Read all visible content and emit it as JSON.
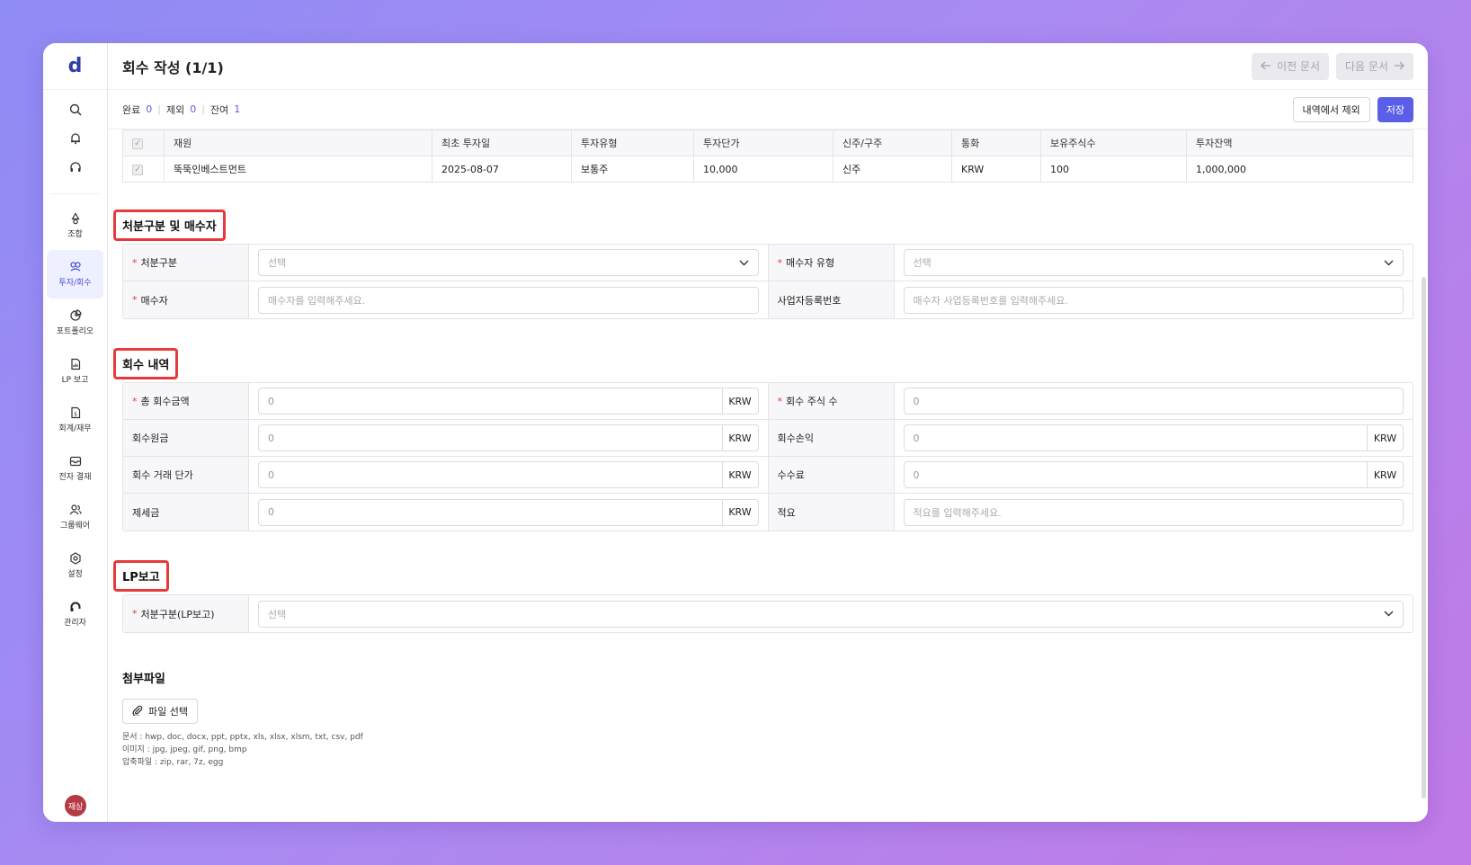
{
  "app": {
    "logo": "d"
  },
  "sidebar": {
    "items": [
      {
        "label": "조합",
        "icon": "recycle-icon"
      },
      {
        "label": "투자/회수",
        "icon": "investment-icon",
        "active": true
      },
      {
        "label": "포트폴리오",
        "icon": "pie-chart-icon"
      },
      {
        "label": "LP 보고",
        "icon": "report-icon"
      },
      {
        "label": "회계/재무",
        "icon": "accounting-icon"
      },
      {
        "label": "전자 결재",
        "icon": "inbox-icon"
      },
      {
        "label": "그룹웨어",
        "icon": "users-icon"
      },
      {
        "label": "설정",
        "icon": "settings-icon"
      },
      {
        "label": "관리자",
        "icon": "headset-icon"
      }
    ],
    "avatar": "재상"
  },
  "header": {
    "title": "회수 작성 (1/1)",
    "prev_label": "이전 문서",
    "next_label": "다음 문서"
  },
  "status": {
    "done_label": "완료",
    "done_count": "0",
    "excluded_label": "제외",
    "excluded_count": "0",
    "remaining_label": "잔여",
    "remaining_count": "1"
  },
  "toolbar": {
    "exclude_label": "내역에서 제외",
    "save_label": "저장"
  },
  "table": {
    "headers": [
      "재원",
      "최초 투자일",
      "투자유형",
      "투자단가",
      "신주/구주",
      "통화",
      "보유주식수",
      "투자잔액"
    ],
    "rows": [
      [
        "뚝뚝인베스트먼트",
        "2025-08-07",
        "보통주",
        "10,000",
        "신주",
        "KRW",
        "100",
        "1,000,000"
      ]
    ]
  },
  "disposal": {
    "title": "처분구분 및 매수자",
    "type_label": "처분구분",
    "type_placeholder": "선택",
    "buyer_type_label": "매수자 유형",
    "buyer_type_placeholder": "선택",
    "buyer_label": "매수자",
    "buyer_placeholder": "매수자를 입력해주세요.",
    "biz_no_label": "사업자등록번호",
    "biz_no_placeholder": "매수자 사업등록번호를 입력해주세요."
  },
  "recovery": {
    "title": "회수 내역",
    "total_label": "총 회수금액",
    "total_value": "0",
    "total_unit": "KRW",
    "shares_label": "회수 주식 수",
    "shares_value": "0",
    "principal_label": "회수원금",
    "principal_value": "0",
    "principal_unit": "KRW",
    "profit_label": "회수손익",
    "profit_value": "0",
    "profit_unit": "KRW",
    "unit_price_label": "회수 거래 단가",
    "unit_price_value": "0",
    "unit_price_unit": "KRW",
    "fee_label": "수수료",
    "fee_value": "0",
    "fee_unit": "KRW",
    "tax_label": "제세금",
    "tax_value": "0",
    "tax_unit": "KRW",
    "memo_label": "적요",
    "memo_placeholder": "적요를 입력해주세요."
  },
  "lp": {
    "title": "LP보고",
    "type_label": "처분구분(LP보고)",
    "type_placeholder": "선택"
  },
  "attachments": {
    "title": "첨부파일",
    "button_label": "파일 선택",
    "note_docs": "문서 : hwp, doc, docx, ppt, pptx, xls, xlsx, xlsm, txt, csv, pdf",
    "note_images": "이미지 : jpg, jpeg, gif, png, bmp",
    "note_archives": "압축파일 : zip, rar, 7z, egg"
  },
  "colors": {
    "accent": "#5a5fe8",
    "highlight": "#e8393a",
    "required": "#e23b3b"
  }
}
